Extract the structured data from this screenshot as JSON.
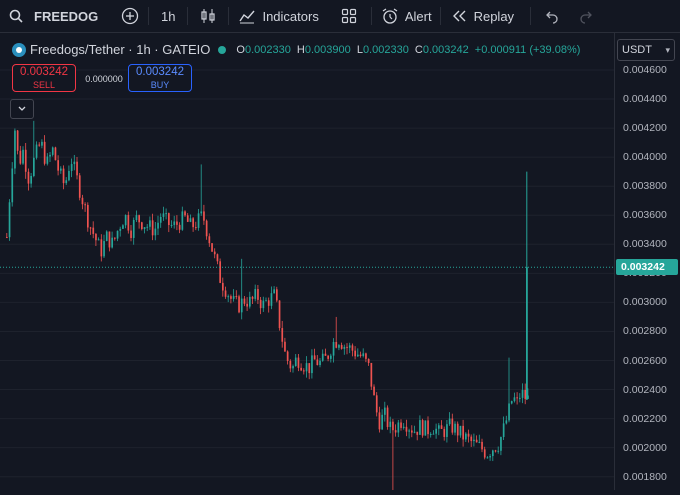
{
  "toolbar": {
    "symbol": "FREEDOG",
    "interval": "1h",
    "indicators_label": "Indicators",
    "alert_label": "Alert",
    "replay_label": "Replay"
  },
  "legend": {
    "title": "Freedogs/Tether · 1h · GATEIO",
    "o_label": "O",
    "o_value": "0.002330",
    "h_label": "H",
    "h_value": "0.003900",
    "l_label": "L",
    "l_value": "0.002330",
    "c_label": "C",
    "c_value": "0.003242",
    "change": "+0.000911 (+39.08%)"
  },
  "trade": {
    "sell_price": "0.003242",
    "sell_label": "SELL",
    "spread": "0.000000",
    "buy_price": "0.003242",
    "buy_label": "BUY"
  },
  "currency": "USDT",
  "price_axis": {
    "ticks": [
      "0.004600",
      "0.004400",
      "0.004200",
      "0.004000",
      "0.003800",
      "0.003600",
      "0.003400",
      "0.003200",
      "0.003000",
      "0.002800",
      "0.002600",
      "0.002400",
      "0.002200",
      "0.002000",
      "0.001800"
    ],
    "current_price": "0.003242"
  },
  "colors": {
    "up": "#26a69a",
    "down": "#ef5350",
    "background": "#131722"
  },
  "chart_data": {
    "type": "candlestick",
    "up_color": "#26a69a",
    "down_color": "#ef5350",
    "last_price": 0.003242,
    "ylim": [
      0.00175,
      0.00465
    ],
    "close_path": [
      [
        0,
        0.00345
      ],
      [
        4,
        0.00385
      ],
      [
        8,
        0.0042
      ],
      [
        12,
        0.00395
      ],
      [
        16,
        0.00405
      ],
      [
        22,
        0.00385
      ],
      [
        28,
        0.004
      ],
      [
        34,
        0.0041
      ],
      [
        40,
        0.00395
      ],
      [
        46,
        0.00405
      ],
      [
        52,
        0.0039
      ],
      [
        58,
        0.0038
      ],
      [
        64,
        0.004
      ],
      [
        70,
        0.00385
      ],
      [
        76,
        0.0037
      ],
      [
        82,
        0.00355
      ],
      [
        88,
        0.00345
      ],
      [
        94,
        0.00335
      ],
      [
        100,
        0.00345
      ],
      [
        106,
        0.0034
      ],
      [
        112,
        0.00352
      ],
      [
        118,
        0.0036
      ],
      [
        124,
        0.0035
      ],
      [
        130,
        0.00358
      ],
      [
        136,
        0.00355
      ],
      [
        142,
        0.00352
      ],
      [
        148,
        0.0035
      ],
      [
        154,
        0.0036
      ],
      [
        160,
        0.00355
      ],
      [
        166,
        0.00352
      ],
      [
        172,
        0.00355
      ],
      [
        178,
        0.00358
      ],
      [
        184,
        0.00352
      ],
      [
        190,
        0.00355
      ],
      [
        196,
        0.0036
      ],
      [
        202,
        0.00345
      ],
      [
        208,
        0.0033
      ],
      [
        214,
        0.00315
      ],
      [
        220,
        0.00308
      ],
      [
        226,
        0.003
      ],
      [
        232,
        0.00298
      ],
      [
        238,
        0.00302
      ],
      [
        244,
        0.003
      ],
      [
        250,
        0.00305
      ],
      [
        256,
        0.00298
      ],
      [
        262,
        0.00302
      ],
      [
        268,
        0.00305
      ],
      [
        274,
        0.0028
      ],
      [
        278,
        0.00265
      ],
      [
        282,
        0.00258
      ],
      [
        286,
        0.00255
      ],
      [
        290,
        0.00262
      ],
      [
        296,
        0.00258
      ],
      [
        302,
        0.00255
      ],
      [
        308,
        0.0026
      ],
      [
        314,
        0.00258
      ],
      [
        320,
        0.00262
      ],
      [
        326,
        0.00272
      ],
      [
        332,
        0.00275
      ],
      [
        338,
        0.0027
      ],
      [
        344,
        0.00268
      ],
      [
        350,
        0.00265
      ],
      [
        356,
        0.00262
      ],
      [
        362,
        0.00255
      ],
      [
        368,
        0.0023
      ],
      [
        372,
        0.00218
      ],
      [
        378,
        0.00222
      ],
      [
        384,
        0.00212
      ],
      [
        390,
        0.00215
      ],
      [
        396,
        0.0022
      ],
      [
        402,
        0.00215
      ],
      [
        408,
        0.00212
      ],
      [
        414,
        0.00215
      ],
      [
        420,
        0.00212
      ],
      [
        426,
        0.00215
      ],
      [
        432,
        0.0021
      ],
      [
        438,
        0.00212
      ],
      [
        444,
        0.00215
      ],
      [
        450,
        0.00212
      ],
      [
        456,
        0.00208
      ],
      [
        462,
        0.00205
      ],
      [
        468,
        0.00202
      ],
      [
        474,
        0.002
      ],
      [
        480,
        0.00196
      ],
      [
        486,
        0.002
      ],
      [
        492,
        0.00203
      ],
      [
        498,
        0.00215
      ],
      [
        502,
        0.00225
      ],
      [
        506,
        0.00235
      ],
      [
        510,
        0.0023
      ],
      [
        514,
        0.00238
      ],
      [
        518,
        0.00235
      ],
      [
        522,
        0.00233
      ]
    ],
    "spikes": [
      {
        "x": 27,
        "h": 0.00425
      },
      {
        "x": 195,
        "h": 0.00395
      },
      {
        "x": 235,
        "h": 0.0033
      },
      {
        "x": 330,
        "h": 0.0029
      },
      {
        "x": 386,
        "l": 0.0017
      },
      {
        "x": 502,
        "h": 0.00262
      }
    ],
    "last_candle": {
      "o": 0.00233,
      "h": 0.0039,
      "l": 0.00233,
      "c": 0.003242
    }
  }
}
